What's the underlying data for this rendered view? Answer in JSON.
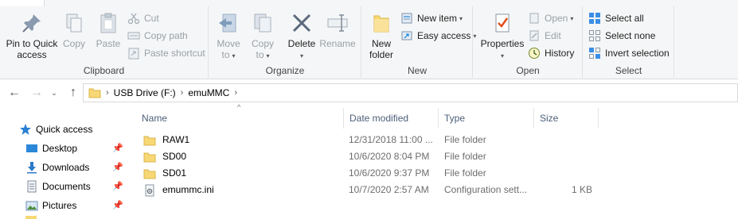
{
  "ribbon": {
    "clipboard": {
      "label": "Clipboard",
      "pin_label_1": "Pin to Quick",
      "pin_label_2": "access",
      "copy": "Copy",
      "paste": "Paste",
      "cut": "Cut",
      "copy_path": "Copy path",
      "paste_shortcut": "Paste shortcut"
    },
    "organize": {
      "label": "Organize",
      "move_to_1": "Move",
      "move_to_2": "to",
      "copy_to_1": "Copy",
      "copy_to_2": "to",
      "delete": "Delete",
      "rename": "Rename"
    },
    "new": {
      "label": "New",
      "new_folder_1": "New",
      "new_folder_2": "folder",
      "new_item": "New item",
      "easy_access": "Easy access"
    },
    "open": {
      "label": "Open",
      "properties": "Properties",
      "open": "Open",
      "edit": "Edit",
      "history": "History"
    },
    "select": {
      "label": "Select",
      "select_all": "Select all",
      "select_none": "Select none",
      "invert_selection": "Invert selection"
    }
  },
  "address": {
    "crumbs": [
      "USB Drive (F:)",
      "emuMMC"
    ]
  },
  "navpane": {
    "items": [
      {
        "label": "Quick access",
        "icon": "star-icon"
      },
      {
        "label": "Desktop",
        "icon": "desktop-icon"
      },
      {
        "label": "Downloads",
        "icon": "download-icon"
      },
      {
        "label": "Documents",
        "icon": "document-icon"
      },
      {
        "label": "Pictures",
        "icon": "pictures-icon"
      }
    ]
  },
  "filelist": {
    "columns": [
      "Name",
      "Date modified",
      "Type",
      "Size"
    ],
    "rows": [
      {
        "name": "RAW1",
        "date": "12/31/2018 11:00 ...",
        "type": "File folder",
        "size": "",
        "icon": "folder-icon"
      },
      {
        "name": "SD00",
        "date": "10/6/2020 8:04 PM",
        "type": "File folder",
        "size": "",
        "icon": "folder-icon"
      },
      {
        "name": "SD01",
        "date": "10/6/2020 9:37 PM",
        "type": "File folder",
        "size": "",
        "icon": "folder-icon"
      },
      {
        "name": "emummc.ini",
        "date": "10/7/2020 2:57 AM",
        "type": "Configuration sett...",
        "size": "1 KB",
        "icon": "settings-file-icon"
      }
    ]
  },
  "colors": {
    "accent": "#0078d7",
    "folder": "#f8d775",
    "disabled": "#9aa0a6",
    "header_text": "#4c607a"
  }
}
